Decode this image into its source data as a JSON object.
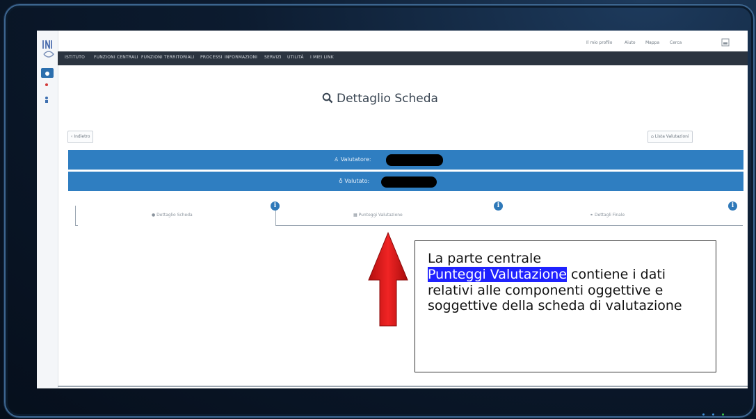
{
  "nav": {
    "items": [
      "ISTITUTO",
      "FUNZIONI CENTRALI",
      "FUNZIONI TERRITORIALI",
      "PROCESSI",
      "INFORMAZIONI",
      "SERVIZI",
      "UTILITÀ",
      "I MIEI LINK"
    ],
    "utility": [
      "Il mio profilo",
      "Aiuto",
      "Mappa",
      "Cerca"
    ]
  },
  "page": {
    "title": "Dettaglio Scheda",
    "back_button": "Indietro",
    "list_button": "Lista Valutazioni"
  },
  "valutatore_label": "Valutatore:",
  "valutato_label": "Valutato:",
  "tabs": [
    "Dettaglio Scheda",
    "Punteggi Valutazione",
    "Dettagli Finale"
  ],
  "info_icon_glyph": "i",
  "callout": {
    "line1": "La parte centrale",
    "highlight": "Punteggi Valutazione",
    "rest": " contiene i dati relativi alle componenti oggettive e soggettive della scheda di valutazione"
  },
  "colors": {
    "accent_blue": "#2f7ec1",
    "nav_dark": "#2b3440",
    "highlight": "#1f22ff",
    "arrow_red": "#e31b1b"
  }
}
